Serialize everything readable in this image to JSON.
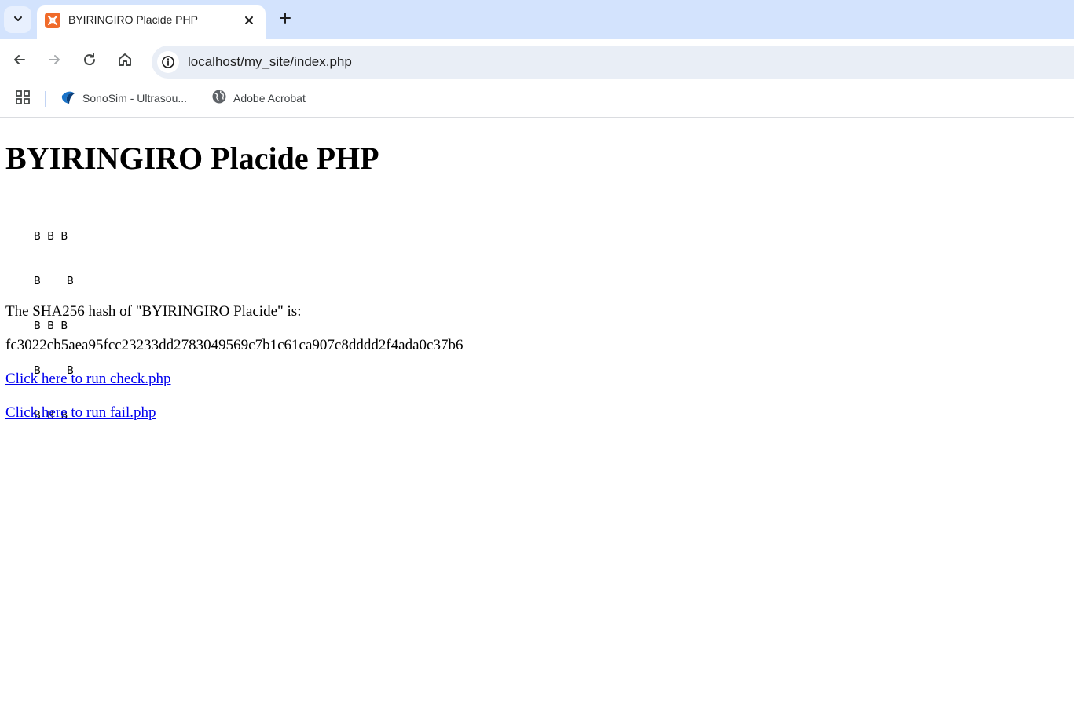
{
  "browser": {
    "tab": {
      "title": "BYIRINGIRO Placide PHP",
      "favicon": "xampp-icon"
    },
    "toolbar": {
      "url": "localhost/my_site/index.php"
    },
    "bookmarks": [
      {
        "label": "SonoSim - Ultrasou...",
        "icon": "sonosim-icon"
      },
      {
        "label": "Adobe Acrobat",
        "icon": "globe-icon"
      }
    ],
    "colors": {
      "tabstrip": "#d3e3fd",
      "omnibox": "#e9eef6",
      "favicon": "#f06b2a",
      "link": "#0000ee"
    }
  },
  "page": {
    "heading": "BYIRINGIRO Placide PHP",
    "pattern": [
      "B  B  B",
      "B        B",
      "B  B  B",
      "B        B",
      "B  B  B"
    ],
    "hash_intro": "The SHA256 hash of \"BYIRINGIRO Placide\" is:",
    "hash_value": "fc3022cb5aea95fcc23233dd2783049569c7b1c61ca907c8dddd2f4ada0c37b6",
    "links": [
      {
        "label": "Click here to run check.php"
      },
      {
        "label": "Click here to run fail.php"
      }
    ]
  }
}
